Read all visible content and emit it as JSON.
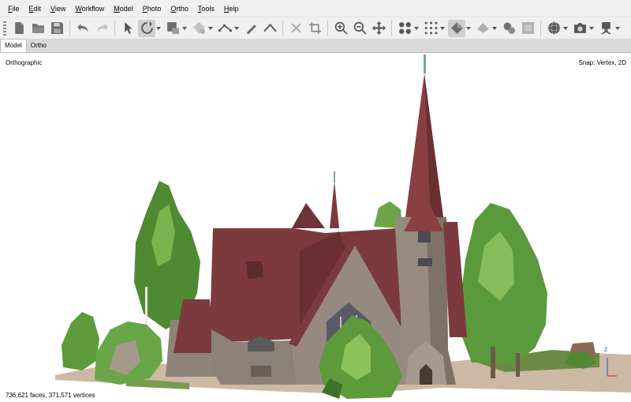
{
  "menu": [
    {
      "mnemonic": "F",
      "rest": "ile"
    },
    {
      "mnemonic": "E",
      "rest": "dit"
    },
    {
      "mnemonic": "V",
      "rest": "iew"
    },
    {
      "mnemonic": "W",
      "rest": "orkflow"
    },
    {
      "mnemonic": "M",
      "rest": "odel"
    },
    {
      "mnemonic": "P",
      "rest": "hoto"
    },
    {
      "mnemonic": "O",
      "rest": "rtho"
    },
    {
      "mnemonic": "T",
      "rest": "ools"
    },
    {
      "mnemonic": "H",
      "rest": "elp"
    }
  ],
  "tabs": [
    {
      "label": "Model",
      "active": true
    },
    {
      "label": "Ortho",
      "active": false
    }
  ],
  "viewport": {
    "projection": "Orthographic",
    "snap": "Snap: Vertex, 2D",
    "stats": "736,621 faces, 371,571 vertices",
    "axis_label": "Z"
  },
  "toolbar": [
    "new-document-icon",
    "open-folder-icon",
    "save-icon",
    "undo-icon",
    "redo-icon",
    "navigation-pointer-icon",
    "rotate-object-icon",
    "region-selection-icon",
    "free-form-selection-icon",
    "ruler-icon",
    "draw-polyline-icon",
    "draw-polygon-icon",
    "delete-icon",
    "crop-icon",
    "zoom-in-icon",
    "zoom-out-icon",
    "move-icon",
    "show-cameras-icon",
    "show-points-icon",
    "model-shaded-icon",
    "model-solid-icon",
    "texture-icon",
    "dem-icon",
    "sphere-icon",
    "capture-icon",
    "camera-settings-icon"
  ],
  "colors": {
    "chrome": "#f0f0f0",
    "tab_bar": "#d9d9d9",
    "roof": "#7c3a3e",
    "stone": "#8c8178",
    "foliage": "#4f8a32",
    "axis_z": "#2050c8"
  }
}
